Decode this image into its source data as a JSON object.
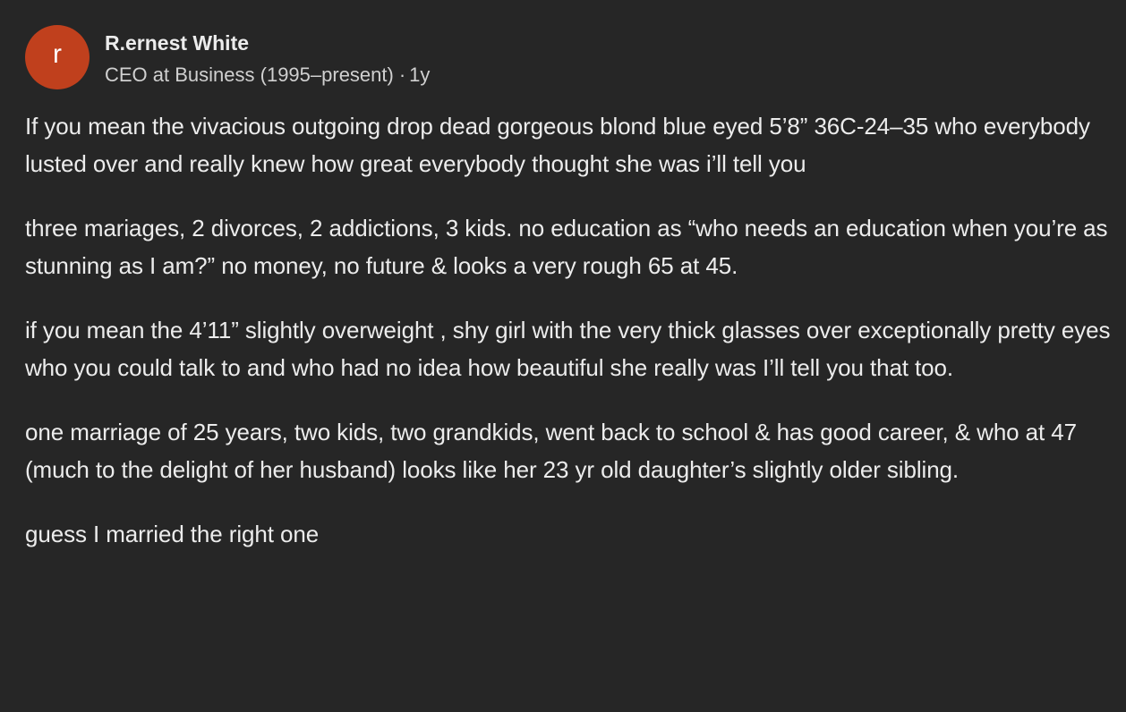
{
  "author": {
    "avatar_letter": "r",
    "avatar_color": "#c0401d",
    "name": "R.ernest White",
    "credential": "CEO at Business (1995–present)",
    "separator": "·",
    "time": "1y"
  },
  "answer": {
    "paragraphs": [
      "If you mean the vivacious outgoing drop dead gorgeous blond blue eyed 5’8” 36C-24–35 who everybody lusted over and really knew how great everybody thought she was i’ll tell you",
      "three mariages, 2 divorces, 2 addictions, 3 kids. no education as “who needs an education when you’re as stunning as I am?” no money, no future & looks a very rough 65 at 45.",
      "if you mean the 4’11” slightly overweight , shy girl with the very thick glasses over exceptionally pretty eyes who you could talk to and who had no idea how beautiful she really was I’ll tell you that too.",
      "one marriage of 25 years, two kids, two grandkids, went back to school & has good career, & who at 47 (much to the delight of her husband) looks like her 23 yr old daughter’s slightly older sibling.",
      "guess I married the right one"
    ]
  }
}
